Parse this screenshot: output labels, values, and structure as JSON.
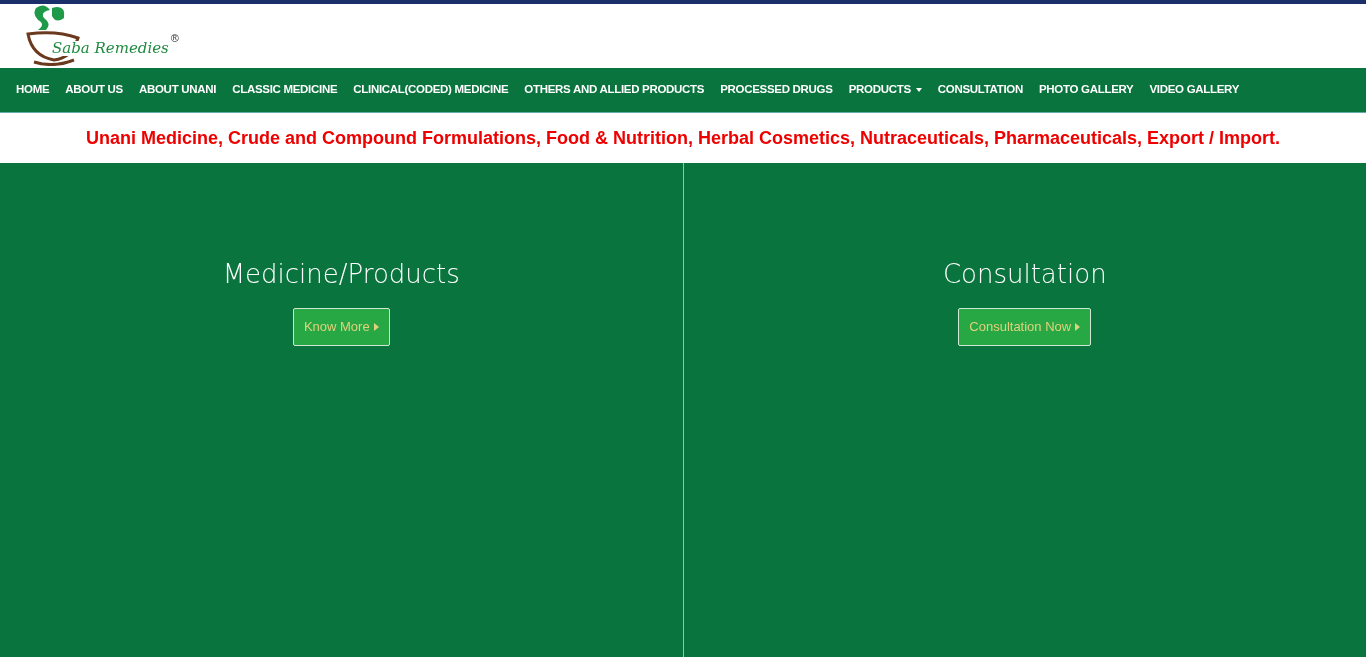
{
  "logo": {
    "name": "Saba Remedies",
    "mark": "®"
  },
  "nav": [
    {
      "label": "HOME",
      "dropdown": false
    },
    {
      "label": "ABOUT US",
      "dropdown": false
    },
    {
      "label": "ABOUT UNANI",
      "dropdown": false
    },
    {
      "label": "CLASSIC MEDICINE",
      "dropdown": false
    },
    {
      "label": "CLINICAL(CODED) MEDICINE",
      "dropdown": false
    },
    {
      "label": "OTHERS AND ALLIED PRODUCTS",
      "dropdown": false
    },
    {
      "label": "PROCESSED DRUGS",
      "dropdown": false
    },
    {
      "label": "PRODUCTS",
      "dropdown": true
    },
    {
      "label": "CONSULTATION",
      "dropdown": false
    },
    {
      "label": "PHOTO GALLERY",
      "dropdown": false
    },
    {
      "label": "VIDEO GALLERY",
      "dropdown": false
    }
  ],
  "tagline": "Unani Medicine, Crude and Compound Formulations, Food & Nutrition, Herbal Cosmetics, Nutraceuticals, Pharmaceuticals, Export / Import.",
  "panels": [
    {
      "title": "Medicine/Products",
      "button": "Know More"
    },
    {
      "title": "Consultation",
      "button": "Consultation Now"
    }
  ]
}
